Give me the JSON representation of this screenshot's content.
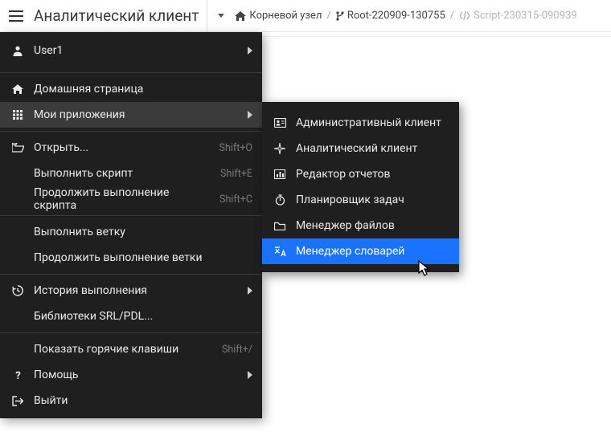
{
  "header": {
    "app_title": "Аналитический клиент"
  },
  "breadcrumb": {
    "root": "Корневой узел",
    "node": "Root-220909-130755",
    "script": "Script-230315-090939"
  },
  "menu": {
    "user": "User1",
    "home": "Домашняя страница",
    "my_apps": "Мои приложения",
    "open": "Открыть...",
    "open_sc": "Shift+O",
    "run_script": "Выполнить скрипт",
    "run_script_sc": "Shift+E",
    "cont_script": "Продолжить выполнение скрипта",
    "cont_script_sc": "Shift+C",
    "run_branch": "Выполнить ветку",
    "cont_branch": "Продолжить выполнение ветки",
    "history": "История выполнения",
    "libs": "Библиотеки SRL/PDL...",
    "hotkeys": "Показать горячие клавиши",
    "hotkeys_sc": "Shift+/",
    "help": "Помощь",
    "exit": "Выйти"
  },
  "submenu": {
    "admin": "Административный клиент",
    "analytic": "Аналитический клиент",
    "reports": "Редактор отчетов",
    "scheduler": "Планировщик задач",
    "files": "Менеджер файлов",
    "dicts": "Менеджер словарей"
  }
}
